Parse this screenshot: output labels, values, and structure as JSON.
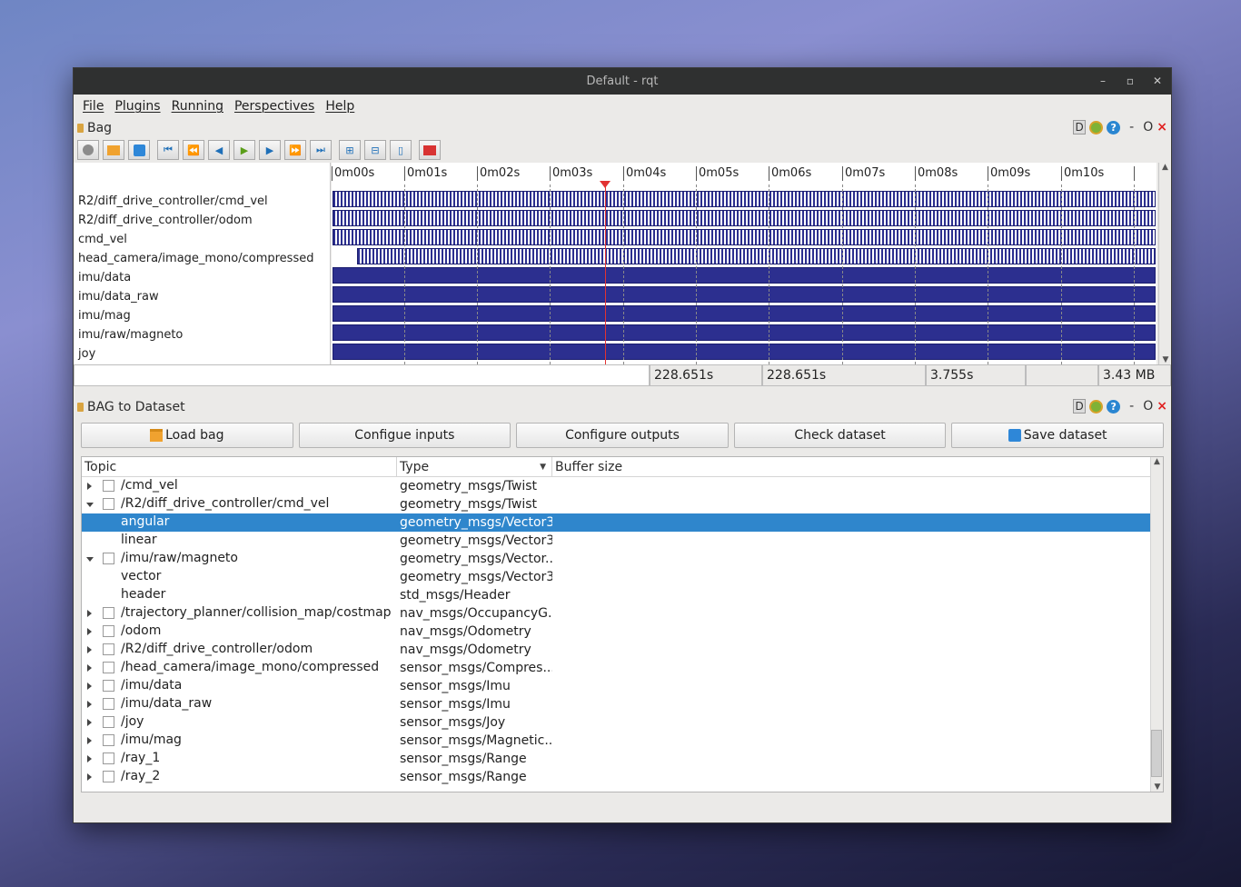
{
  "window": {
    "title": "Default - rqt",
    "controls": [
      "–",
      "▫",
      "✕"
    ]
  },
  "menubar": {
    "items": [
      "File",
      "Plugins",
      "Running",
      "Perspectives",
      "Help"
    ]
  },
  "bag_panel": {
    "title": "Bag",
    "ctrl_d": "D",
    "ctrl_help": "?",
    "ctrl_min": "-",
    "ctrl_o": "O",
    "ctrl_close": "×",
    "toolbar_icons": [
      "record-icon",
      "open-folder-icon",
      "save-icon",
      "skip-to-start-icon",
      "rewind-icon",
      "step-back-icon",
      "play-icon",
      "step-forward-icon",
      "fast-forward-icon",
      "skip-to-end-icon",
      "zoom-in-icon",
      "zoom-out-icon",
      "zoom-reset-icon",
      "thumbnail-icon"
    ],
    "ticks": [
      "0m00s",
      "0m01s",
      "0m02s",
      "0m03s",
      "0m04s",
      "0m05s",
      "0m06s",
      "0m07s",
      "0m08s",
      "0m09s",
      "0m10s"
    ],
    "topics": [
      "R2/diff_drive_controller/cmd_vel",
      "R2/diff_drive_controller/odom",
      "cmd_vel",
      "head_camera/image_mono/compressed",
      "imu/data",
      "imu/data_raw",
      "imu/mag",
      "imu/raw/magneto",
      "joy"
    ],
    "status": {
      "start": "228.651s",
      "end": "228.651s",
      "position": "3.755s",
      "size": "3.43 MB"
    }
  },
  "dataset_panel": {
    "title": "BAG to Dataset",
    "ctrl_d": "D",
    "ctrl_help": "?",
    "ctrl_min": "-",
    "ctrl_o": "O",
    "ctrl_close": "×",
    "buttons": {
      "load": "Load bag",
      "inputs": "Configue inputs",
      "outputs": "Configure outputs",
      "check": "Check dataset",
      "save": "Save dataset"
    },
    "columns": {
      "topic": "Topic",
      "type": "Type",
      "buffer": "Buffer size"
    },
    "rows": [
      {
        "topic": "/cmd_vel",
        "type": "geometry_msgs/Twist",
        "level": 0,
        "expanded": false
      },
      {
        "topic": "/R2/diff_drive_controller/cmd_vel",
        "type": "geometry_msgs/Twist",
        "level": 0,
        "expanded": true
      },
      {
        "topic": "angular",
        "type": "geometry_msgs/Vector3",
        "level": 1,
        "selected": true
      },
      {
        "topic": "linear",
        "type": "geometry_msgs/Vector3",
        "level": 1
      },
      {
        "topic": "/imu/raw/magneto",
        "type": "geometry_msgs/Vector...",
        "level": 0,
        "expanded": true
      },
      {
        "topic": "vector",
        "type": "geometry_msgs/Vector3",
        "level": 1
      },
      {
        "topic": "header",
        "type": "std_msgs/Header",
        "level": 1
      },
      {
        "topic": "/trajectory_planner/collision_map/costmap",
        "type": "nav_msgs/OccupancyG...",
        "level": 0,
        "expanded": false
      },
      {
        "topic": "/odom",
        "type": "nav_msgs/Odometry",
        "level": 0,
        "expanded": false
      },
      {
        "topic": "/R2/diff_drive_controller/odom",
        "type": "nav_msgs/Odometry",
        "level": 0,
        "expanded": false
      },
      {
        "topic": "/head_camera/image_mono/compressed",
        "type": "sensor_msgs/Compres...",
        "level": 0,
        "expanded": false
      },
      {
        "topic": "/imu/data",
        "type": "sensor_msgs/Imu",
        "level": 0,
        "expanded": false
      },
      {
        "topic": "/imu/data_raw",
        "type": "sensor_msgs/Imu",
        "level": 0,
        "expanded": false
      },
      {
        "topic": "/joy",
        "type": "sensor_msgs/Joy",
        "level": 0,
        "expanded": false
      },
      {
        "topic": "/imu/mag",
        "type": "sensor_msgs/Magnetic...",
        "level": 0,
        "expanded": false
      },
      {
        "topic": "/ray_1",
        "type": "sensor_msgs/Range",
        "level": 0,
        "expanded": false
      },
      {
        "topic": "/ray_2",
        "type": "sensor_msgs/Range",
        "level": 0,
        "expanded": false
      }
    ]
  }
}
